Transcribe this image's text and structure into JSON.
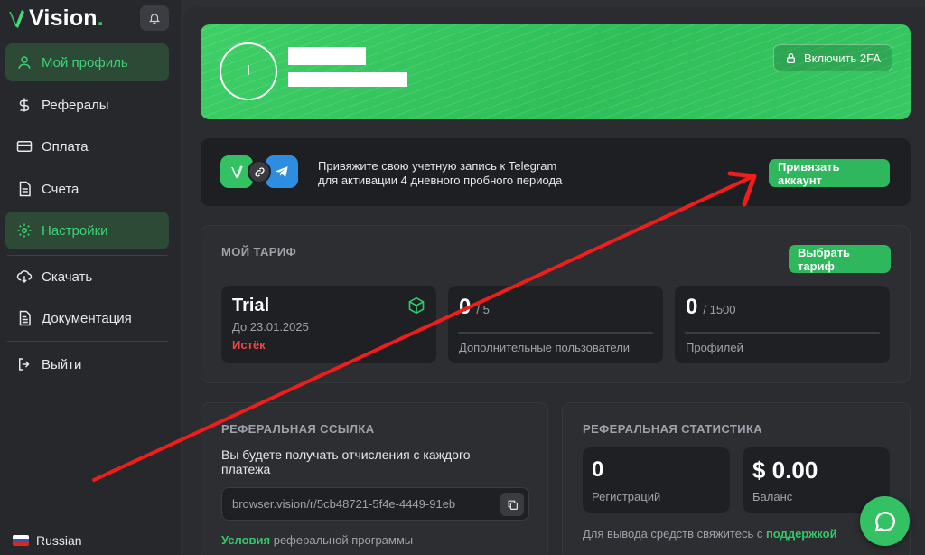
{
  "brand": {
    "name": "Vision",
    "accent": "#34c76a"
  },
  "sidebar": {
    "items": [
      {
        "label": "Мой профиль",
        "icon": "user-icon"
      },
      {
        "label": "Рефералы",
        "icon": "dollar-icon"
      },
      {
        "label": "Оплата",
        "icon": "credit-card-icon"
      },
      {
        "label": "Счета",
        "icon": "document-icon"
      },
      {
        "label": "Настройки",
        "icon": "gear-icon"
      },
      {
        "label": "Скачать",
        "icon": "cloud-download-icon"
      },
      {
        "label": "Документация",
        "icon": "book-icon"
      },
      {
        "label": "Выйти",
        "icon": "logout-icon"
      }
    ],
    "language": "Russian"
  },
  "profile": {
    "avatar_letter": "I",
    "twofa_label": "Включить 2FA"
  },
  "telegram": {
    "line1": "Привяжите свою учетную запись к Telegram",
    "line2": "для активации 4 дневного пробного периода",
    "button": "Привязать аккаунт"
  },
  "tariff": {
    "title": "МОЙ ТАРИФ",
    "button": "Выбрать тариф",
    "plan": {
      "name": "Trial",
      "until": "До 23.01.2025",
      "status": "Истёк",
      "status_color": "#ef4444"
    },
    "users": {
      "value": "0",
      "limit": "/ 5",
      "label": "Дополнительные пользователи",
      "fill": 0
    },
    "profiles": {
      "value": "0",
      "limit": "/ 1500",
      "label": "Профилей",
      "fill": 0
    }
  },
  "referral_link": {
    "title": "РЕФЕРАЛЬНАЯ ССЫЛКА",
    "desc_line1": "Вы будете получать отчисления с каждого",
    "desc_line2": "платежа",
    "url": "browser.vision/r/5cb48721-5f4e-4449-91eb",
    "terms_link": "Условия",
    "terms_rest": " реферальной программы"
  },
  "referral_stats": {
    "title": "РЕФЕРАЛЬНАЯ СТАТИСТИКА",
    "registrations_value": "0",
    "registrations_label": "Регистраций",
    "balance_value": "$ 0.00",
    "balance_label": "Баланс",
    "withdraw_text": "Для вывода средств свяжитесь с ",
    "withdraw_link": "поддержкой"
  }
}
